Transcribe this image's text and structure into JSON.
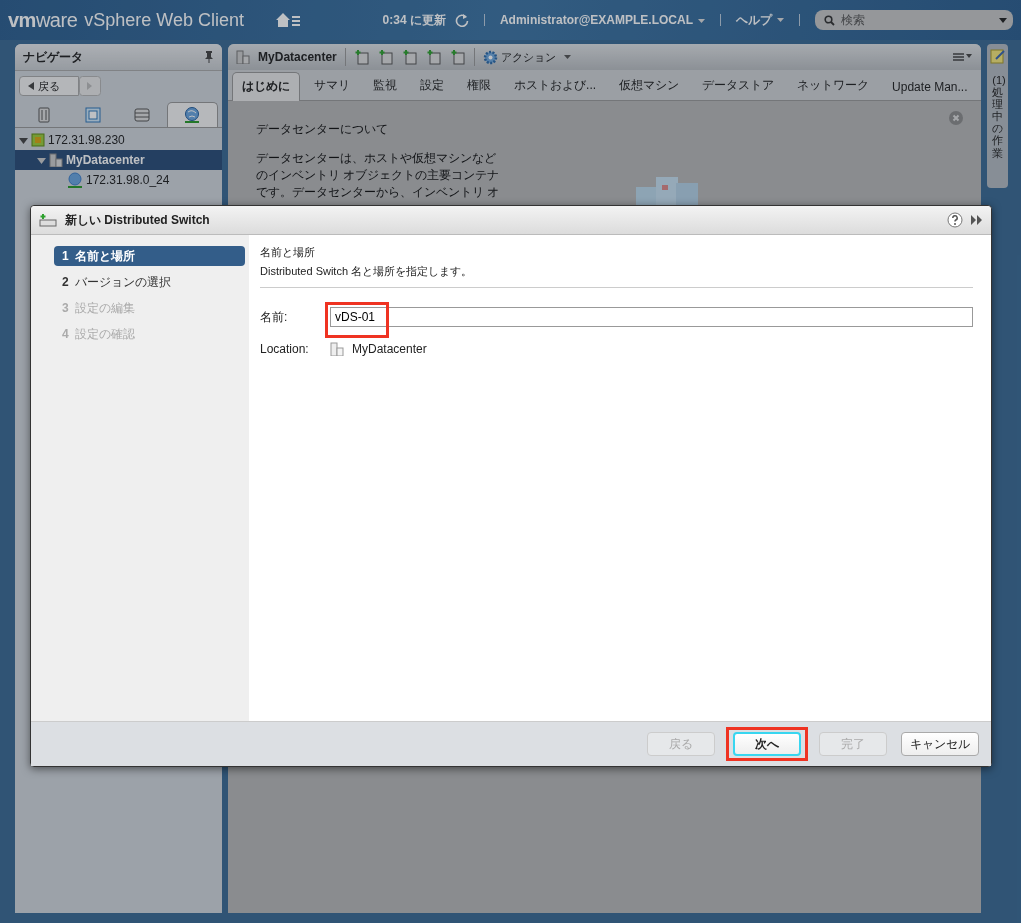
{
  "header": {
    "brand": "**vm**ware",
    "product": "vSphere Web Client",
    "refresh": "0:34 に更新",
    "user": "Administrator@EXAMPLE.LOCAL",
    "help": "ヘルプ",
    "search": {
      "placeholder": "検索"
    }
  },
  "navigator": {
    "title": "ナビゲータ",
    "back": "戻る",
    "tabs": [
      {
        "kind": "hosts",
        "selected": false
      },
      {
        "kind": "vms",
        "selected": false
      },
      {
        "kind": "storage",
        "selected": false
      },
      {
        "kind": "network",
        "selected": true
      }
    ],
    "tree": [
      {
        "label": "172.31.98.230",
        "kind": "vcenter",
        "expanded": true,
        "selected": false,
        "children": [
          {
            "label": "MyDatacenter",
            "kind": "datacenter",
            "expanded": true,
            "selected": true,
            "children": [
              {
                "label": "172.31.98.0_24",
                "kind": "network",
                "selected": false
              }
            ]
          }
        ]
      }
    ]
  },
  "main": {
    "title": "MyDatacenter",
    "actions": "アクション",
    "tabs": [
      {
        "label": "はじめに",
        "selected": true
      },
      {
        "label": "サマリ",
        "selected": false
      },
      {
        "label": "監視",
        "selected": false
      },
      {
        "label": "設定",
        "selected": false
      },
      {
        "label": "権限",
        "selected": false
      },
      {
        "label": "ホストおよび...",
        "selected": false
      },
      {
        "label": "仮想マシン",
        "selected": false
      },
      {
        "label": "データストア",
        "selected": false
      },
      {
        "label": "ネットワーク",
        "selected": false
      },
      {
        "label": "Update Man...",
        "selected": false
      }
    ],
    "heading": "データセンターについて",
    "paragraph_lines": [
      "データセンターは、ホストや仮想マシンなど",
      "のインベントリ オブジェクトの主要コンテナ",
      "です。データセンターから、インベントリ オ"
    ]
  },
  "tasks": "(1) 処理中の作業",
  "dialog": {
    "title": "新しい Distributed Switch",
    "steps": [
      {
        "number": "1",
        "label": "名前と場所",
        "selected": true,
        "disabled": false
      },
      {
        "number": "2",
        "label": "バージョンの選択",
        "selected": false,
        "disabled": false
      },
      {
        "number": "3",
        "label": "設定の編集",
        "selected": false,
        "disabled": true
      },
      {
        "number": "4",
        "label": "設定の確認",
        "selected": false,
        "disabled": true
      }
    ],
    "page_title": "名前と場所",
    "page_desc": "Distributed Switch 名と場所を指定します。",
    "name_label": "名前:",
    "name_value": "vDS-01",
    "name_highlighted": true,
    "location_label": "Location:",
    "location_value": "MyDatacenter",
    "buttons": [
      {
        "label": "戻る",
        "disabled": true,
        "focused": false,
        "highlighted": false
      },
      {
        "label": "次へ",
        "disabled": false,
        "focused": true,
        "highlighted": true
      },
      {
        "label": "完了",
        "disabled": true,
        "focused": false,
        "highlighted": false
      },
      {
        "label": "キャンセル",
        "disabled": false,
        "focused": false,
        "highlighted": false
      }
    ]
  }
}
